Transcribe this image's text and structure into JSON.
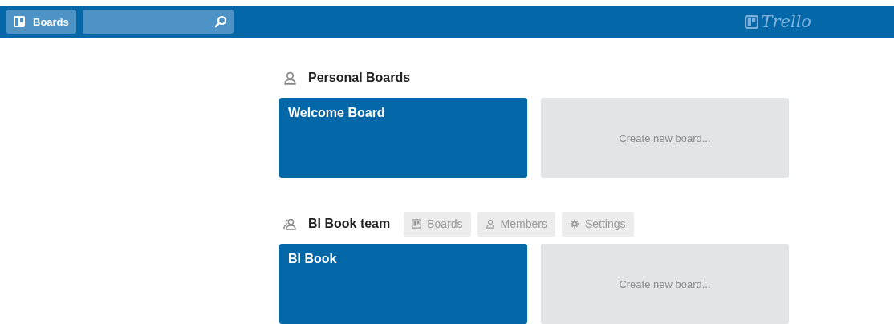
{
  "header": {
    "boards_button": "Boards",
    "logo": "Trello"
  },
  "sections": [
    {
      "kind": "personal",
      "title": "Personal Boards",
      "boards": [
        {
          "kind": "board",
          "title": "Welcome Board"
        },
        {
          "kind": "create",
          "title": "Create new board..."
        }
      ]
    },
    {
      "kind": "team",
      "title": "BI Book team",
      "tabs": [
        {
          "kind": "boards",
          "label": "Boards"
        },
        {
          "kind": "members",
          "label": "Members"
        },
        {
          "kind": "settings",
          "label": "Settings"
        }
      ],
      "boards": [
        {
          "kind": "board",
          "title": "BI Book"
        },
        {
          "kind": "create",
          "title": "Create new board..."
        }
      ]
    }
  ]
}
